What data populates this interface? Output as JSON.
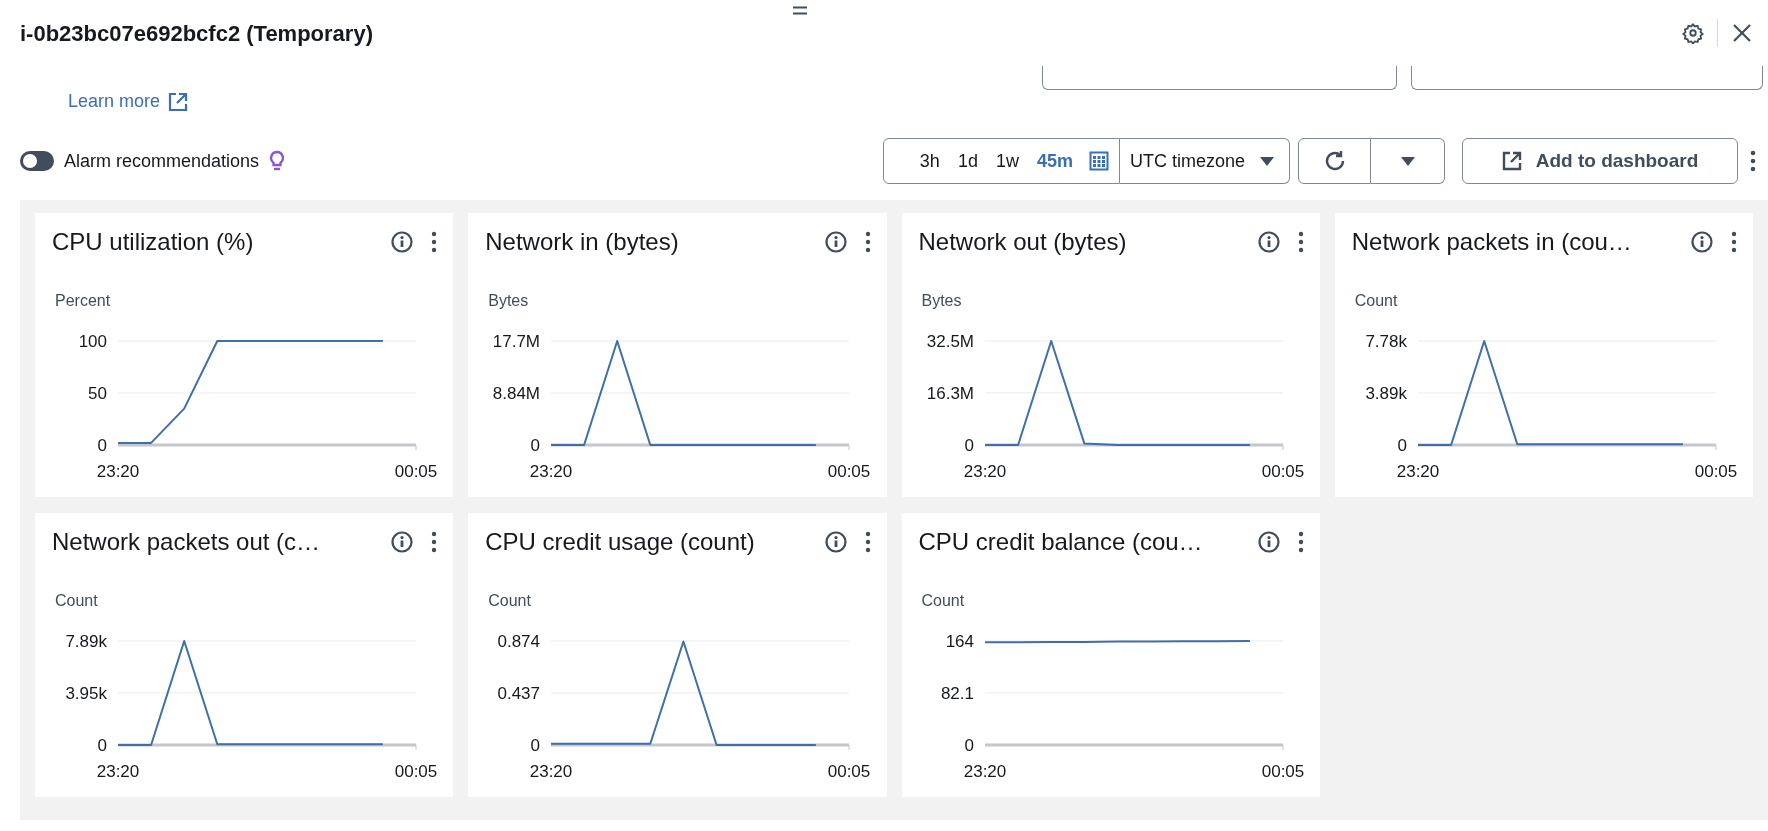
{
  "header": {
    "title": "i-0b23bc07e692bcfc2 (Temporary)"
  },
  "learn_more": {
    "label": "Learn more"
  },
  "alarm_recommendations": {
    "label": "Alarm recommendations",
    "on": false
  },
  "time_range": {
    "options": [
      {
        "label": "3h",
        "selected": false
      },
      {
        "label": "1d",
        "selected": false
      },
      {
        "label": "1w",
        "selected": false
      },
      {
        "label": "45m",
        "selected": true
      }
    ]
  },
  "timezone": {
    "label": "UTC timezone"
  },
  "add_to_dashboard": {
    "label": "Add to dashboard"
  },
  "widgets": [
    {
      "title": "CPU utilization (%)",
      "chart_data": {
        "type": "line",
        "ylabel": "Percent",
        "categories": [
          "23:20",
          null,
          null,
          null,
          null,
          null,
          null,
          null,
          null,
          "00:05"
        ],
        "ylim": [
          0,
          100
        ],
        "yticks": [
          0,
          50,
          100
        ],
        "series": [
          {
            "color": "#3f6fa8",
            "values": [
              2,
              2,
              35,
              100,
              100,
              100,
              100,
              100,
              100,
              null
            ]
          }
        ]
      }
    },
    {
      "title": "Network in (bytes)",
      "chart_data": {
        "type": "line",
        "ylabel": "Bytes",
        "categories": [
          "23:20",
          null,
          null,
          null,
          null,
          null,
          null,
          null,
          null,
          "00:05"
        ],
        "ylim": [
          0,
          17700000
        ],
        "yticks": [
          0,
          {
            "value": 8840000,
            "label": "8.84M"
          },
          {
            "value": 17700000,
            "label": "17.7M"
          }
        ],
        "series": [
          {
            "color": "#3f6fa8",
            "values": [
              0,
              0,
              17700000,
              0,
              0,
              0,
              0,
              0,
              0,
              null
            ]
          }
        ]
      }
    },
    {
      "title": "Network out (bytes)",
      "chart_data": {
        "type": "line",
        "ylabel": "Bytes",
        "categories": [
          "23:20",
          null,
          null,
          null,
          null,
          null,
          null,
          null,
          null,
          "00:05"
        ],
        "ylim": [
          0,
          32500000
        ],
        "yticks": [
          0,
          {
            "value": 16300000,
            "label": "16.3M"
          },
          {
            "value": 32500000,
            "label": "32.5M"
          }
        ],
        "series": [
          {
            "color": "#3f6fa8",
            "values": [
              0,
              0,
              32500000,
              500000,
              0,
              0,
              0,
              0,
              0,
              null
            ]
          }
        ]
      }
    },
    {
      "title": "Network packets in (cou…",
      "chart_data": {
        "type": "line",
        "ylabel": "Count",
        "categories": [
          "23:20",
          null,
          null,
          null,
          null,
          null,
          null,
          null,
          null,
          "00:05"
        ],
        "ylim": [
          0,
          7780
        ],
        "yticks": [
          0,
          {
            "value": 3890,
            "label": "3.89k"
          },
          {
            "value": 7780,
            "label": "7.78k"
          }
        ],
        "series": [
          {
            "color": "#3f6fa8",
            "values": [
              0,
              0,
              7780,
              50,
              50,
              50,
              50,
              50,
              50,
              null
            ]
          }
        ]
      }
    },
    {
      "title": "Network packets out (c…",
      "chart_data": {
        "type": "line",
        "ylabel": "Count",
        "categories": [
          "23:20",
          null,
          null,
          null,
          null,
          null,
          null,
          null,
          null,
          "00:05"
        ],
        "ylim": [
          0,
          7890
        ],
        "yticks": [
          0,
          {
            "value": 3950,
            "label": "3.95k"
          },
          {
            "value": 7890,
            "label": "7.89k"
          }
        ],
        "series": [
          {
            "color": "#3f6fa8",
            "values": [
              0,
              0,
              7890,
              50,
              50,
              50,
              50,
              50,
              50,
              null
            ]
          }
        ]
      }
    },
    {
      "title": "CPU credit usage (count)",
      "chart_data": {
        "type": "line",
        "ylabel": "Count",
        "categories": [
          "23:20",
          null,
          null,
          null,
          null,
          null,
          null,
          null,
          null,
          "00:05"
        ],
        "ylim": [
          0,
          0.874
        ],
        "yticks": [
          0,
          0.437,
          0.874
        ],
        "series": [
          {
            "color": "#3f6fa8",
            "values": [
              0.01,
              0.01,
              0.01,
              0.01,
              0.87,
              0,
              0,
              0,
              0,
              null
            ]
          }
        ]
      }
    },
    {
      "title": "CPU credit balance (cou…",
      "chart_data": {
        "type": "line",
        "ylabel": "Count",
        "categories": [
          "23:20",
          null,
          null,
          null,
          null,
          null,
          null,
          null,
          null,
          "00:05"
        ],
        "ylim": [
          0,
          164
        ],
        "yticks": [
          0,
          82.1,
          164
        ],
        "series": [
          {
            "color": "#3f6fa8",
            "values": [
              162,
              162,
              162.5,
              162.5,
              163,
              163,
              163.5,
              163.5,
              164,
              null
            ]
          }
        ]
      }
    }
  ]
}
